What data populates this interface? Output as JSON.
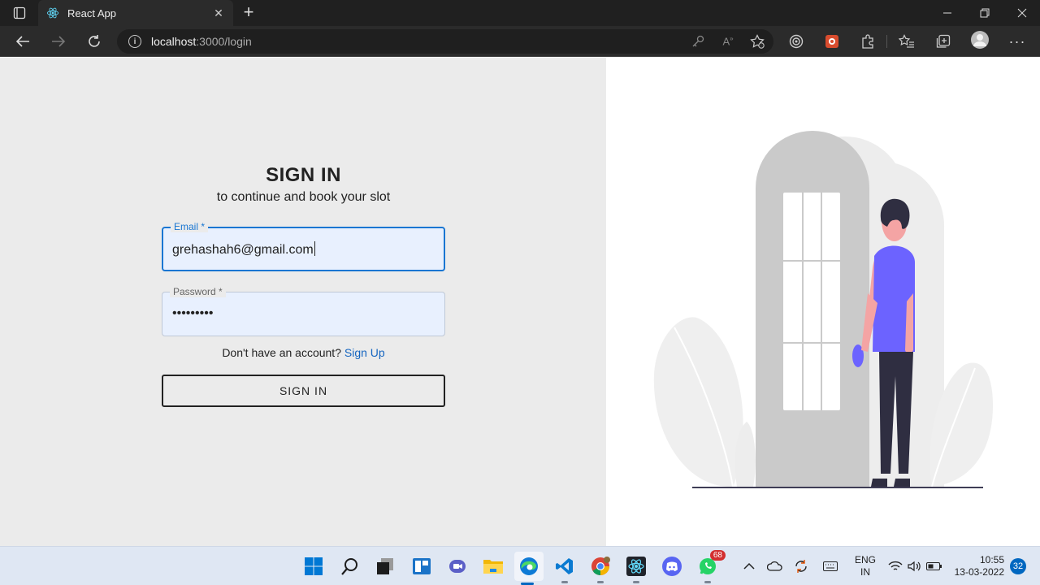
{
  "browser": {
    "tab_title": "React App",
    "url_host": "localhost",
    "url_path": ":3000/login"
  },
  "login": {
    "heading": "SIGN IN",
    "subheading": "to continue and book your slot",
    "email_label": "Email *",
    "email_value": "grehashah6@gmail.com",
    "password_label": "Password *",
    "password_value": "•••••••••",
    "signup_prompt": "Don't have an account?",
    "signup_link": "Sign Up",
    "submit_label": "SIGN IN"
  },
  "taskbar": {
    "whatsapp_badge": "68",
    "lang_line1": "ENG",
    "lang_line2": "IN",
    "time": "10:55",
    "date": "13-03-2022",
    "notifications": "32"
  },
  "colors": {
    "accent": "#1976d2",
    "link": "#1565c0",
    "illustration_purple": "#6c63ff",
    "left_bg": "#ebebeb"
  }
}
